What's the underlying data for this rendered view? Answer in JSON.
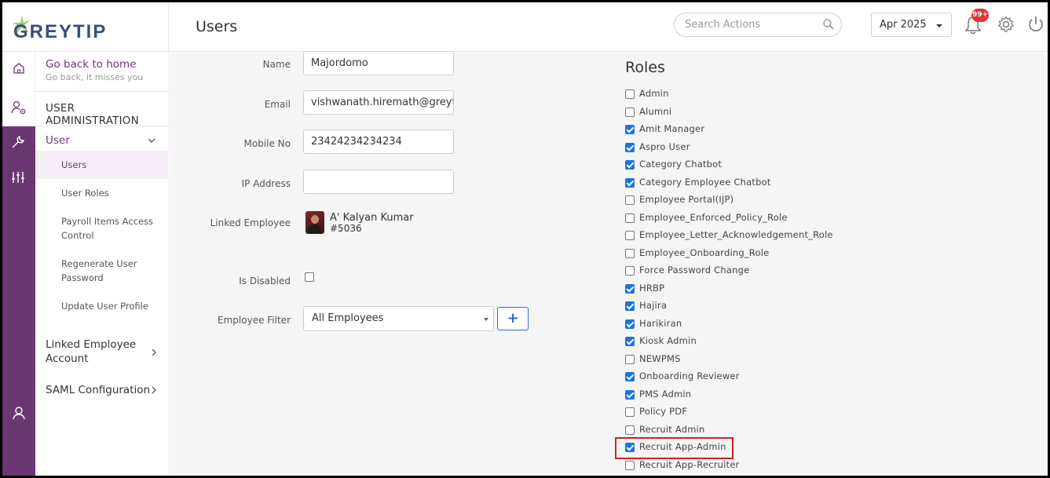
{
  "app": {
    "logo_text": "GREYTIP",
    "page_title": "Users",
    "search_placeholder": "Search Actions",
    "month": "Apr 2025",
    "notif_badge": "99+"
  },
  "sidebar": {
    "home_title": "Go back to home",
    "home_sub": "Go back, it misses you",
    "section": "USER ADMINISTRATION",
    "group_user": "User",
    "items": [
      {
        "label": "Users",
        "active": true
      },
      {
        "label": "User Roles",
        "active": false
      },
      {
        "label": "Payroll Items Access Control",
        "active": false
      },
      {
        "label": "Regenerate User Password",
        "active": false
      },
      {
        "label": "Update User Profile",
        "active": false
      }
    ],
    "group_linked": "Linked Employee Account",
    "group_saml": "SAML Configuration"
  },
  "form": {
    "name_label": "Name",
    "name_value": "Majordomo",
    "email_label": "Email",
    "email_value": "vishwanath.hiremath@greytip",
    "mobile_label": "Mobile No",
    "mobile_value": "23424234234234",
    "ip_label": "IP Address",
    "ip_value": "",
    "linked_label": "Linked Employee",
    "linked_name": "A' Kalyan Kumar",
    "linked_code": "#5036",
    "disabled_label": "Is Disabled",
    "disabled_checked": false,
    "filter_label": "Employee Filter",
    "filter_value": "All Employees",
    "add_label": "+"
  },
  "roles": {
    "title": "Roles",
    "items": [
      {
        "label": "Admin",
        "checked": false
      },
      {
        "label": "Alumni",
        "checked": false
      },
      {
        "label": "Amit Manager",
        "checked": true
      },
      {
        "label": "Aspro User",
        "checked": true
      },
      {
        "label": "Category Chatbot",
        "checked": true
      },
      {
        "label": "Category Employee Chatbot",
        "checked": true
      },
      {
        "label": "Employee Portal(IJP)",
        "checked": false
      },
      {
        "label": "Employee_Enforced_Policy_Role",
        "checked": false
      },
      {
        "label": "Employee_Letter_Acknowledgement_Role",
        "checked": false
      },
      {
        "label": "Employee_Onboarding_Role",
        "checked": false
      },
      {
        "label": "Force Password Change",
        "checked": false
      },
      {
        "label": "HRBP",
        "checked": true
      },
      {
        "label": "Hajira",
        "checked": true
      },
      {
        "label": "Harikiran",
        "checked": true
      },
      {
        "label": "Kiosk Admin",
        "checked": true
      },
      {
        "label": "NEWPMS",
        "checked": false
      },
      {
        "label": "Onboarding Reviewer",
        "checked": true
      },
      {
        "label": "PMS Admin",
        "checked": true
      },
      {
        "label": "Policy PDF",
        "checked": false
      },
      {
        "label": "Recruit Admin",
        "checked": false
      },
      {
        "label": "Recruit App-Admin",
        "checked": true
      },
      {
        "label": "Recruit App-Recruiter",
        "checked": false
      }
    ]
  },
  "colors": {
    "brand_purple": "#6b3773",
    "checkbox_blue": "#1a73e8",
    "highlight_red": "#d32222"
  }
}
